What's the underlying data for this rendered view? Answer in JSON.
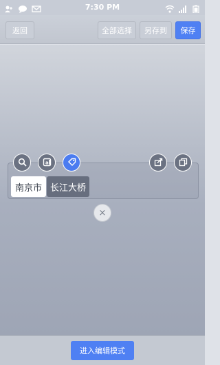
{
  "status_bar": {
    "time": "7:30 PM",
    "left_icons": [
      "user-icon",
      "chat-icon",
      "mail-icon"
    ],
    "right_icons": [
      "wifi-icon",
      "signal-icon",
      "battery-icon"
    ]
  },
  "toolbar": {
    "back_label": "返回",
    "select_all_label": "全部选择",
    "save_as_label": "另存到",
    "save_label": "保存"
  },
  "actions": {
    "left": [
      "search-icon",
      "translate-icon",
      "tag-icon"
    ],
    "right": [
      "share-icon",
      "copy-icon"
    ]
  },
  "words": [
    "南京市",
    "长江大桥"
  ],
  "close_symbol": "×",
  "bottom": {
    "edit_mode_label": "进入编辑模式"
  },
  "colors": {
    "accent": "#4f80f3",
    "chip_dark": "#676e7e"
  }
}
